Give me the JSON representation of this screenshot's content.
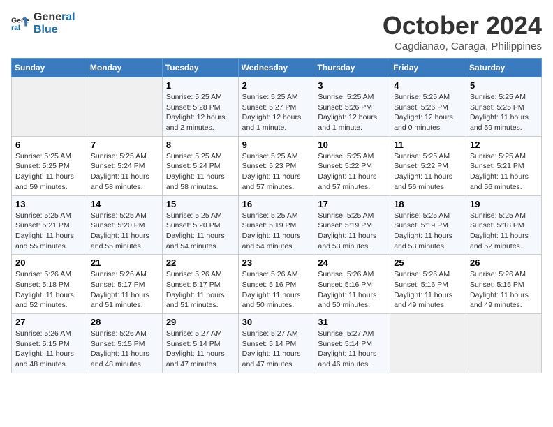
{
  "header": {
    "logo_line1": "General",
    "logo_line2": "Blue",
    "month": "October 2024",
    "location": "Cagdianao, Caraga, Philippines"
  },
  "weekdays": [
    "Sunday",
    "Monday",
    "Tuesday",
    "Wednesday",
    "Thursday",
    "Friday",
    "Saturday"
  ],
  "weeks": [
    [
      {
        "day": "",
        "info": ""
      },
      {
        "day": "",
        "info": ""
      },
      {
        "day": "1",
        "info": "Sunrise: 5:25 AM\nSunset: 5:28 PM\nDaylight: 12 hours\nand 2 minutes."
      },
      {
        "day": "2",
        "info": "Sunrise: 5:25 AM\nSunset: 5:27 PM\nDaylight: 12 hours\nand 1 minute."
      },
      {
        "day": "3",
        "info": "Sunrise: 5:25 AM\nSunset: 5:26 PM\nDaylight: 12 hours\nand 1 minute."
      },
      {
        "day": "4",
        "info": "Sunrise: 5:25 AM\nSunset: 5:26 PM\nDaylight: 12 hours\nand 0 minutes."
      },
      {
        "day": "5",
        "info": "Sunrise: 5:25 AM\nSunset: 5:25 PM\nDaylight: 11 hours\nand 59 minutes."
      }
    ],
    [
      {
        "day": "6",
        "info": "Sunrise: 5:25 AM\nSunset: 5:25 PM\nDaylight: 11 hours\nand 59 minutes."
      },
      {
        "day": "7",
        "info": "Sunrise: 5:25 AM\nSunset: 5:24 PM\nDaylight: 11 hours\nand 58 minutes."
      },
      {
        "day": "8",
        "info": "Sunrise: 5:25 AM\nSunset: 5:24 PM\nDaylight: 11 hours\nand 58 minutes."
      },
      {
        "day": "9",
        "info": "Sunrise: 5:25 AM\nSunset: 5:23 PM\nDaylight: 11 hours\nand 57 minutes."
      },
      {
        "day": "10",
        "info": "Sunrise: 5:25 AM\nSunset: 5:22 PM\nDaylight: 11 hours\nand 57 minutes."
      },
      {
        "day": "11",
        "info": "Sunrise: 5:25 AM\nSunset: 5:22 PM\nDaylight: 11 hours\nand 56 minutes."
      },
      {
        "day": "12",
        "info": "Sunrise: 5:25 AM\nSunset: 5:21 PM\nDaylight: 11 hours\nand 56 minutes."
      }
    ],
    [
      {
        "day": "13",
        "info": "Sunrise: 5:25 AM\nSunset: 5:21 PM\nDaylight: 11 hours\nand 55 minutes."
      },
      {
        "day": "14",
        "info": "Sunrise: 5:25 AM\nSunset: 5:20 PM\nDaylight: 11 hours\nand 55 minutes."
      },
      {
        "day": "15",
        "info": "Sunrise: 5:25 AM\nSunset: 5:20 PM\nDaylight: 11 hours\nand 54 minutes."
      },
      {
        "day": "16",
        "info": "Sunrise: 5:25 AM\nSunset: 5:19 PM\nDaylight: 11 hours\nand 54 minutes."
      },
      {
        "day": "17",
        "info": "Sunrise: 5:25 AM\nSunset: 5:19 PM\nDaylight: 11 hours\nand 53 minutes."
      },
      {
        "day": "18",
        "info": "Sunrise: 5:25 AM\nSunset: 5:19 PM\nDaylight: 11 hours\nand 53 minutes."
      },
      {
        "day": "19",
        "info": "Sunrise: 5:25 AM\nSunset: 5:18 PM\nDaylight: 11 hours\nand 52 minutes."
      }
    ],
    [
      {
        "day": "20",
        "info": "Sunrise: 5:26 AM\nSunset: 5:18 PM\nDaylight: 11 hours\nand 52 minutes."
      },
      {
        "day": "21",
        "info": "Sunrise: 5:26 AM\nSunset: 5:17 PM\nDaylight: 11 hours\nand 51 minutes."
      },
      {
        "day": "22",
        "info": "Sunrise: 5:26 AM\nSunset: 5:17 PM\nDaylight: 11 hours\nand 51 minutes."
      },
      {
        "day": "23",
        "info": "Sunrise: 5:26 AM\nSunset: 5:16 PM\nDaylight: 11 hours\nand 50 minutes."
      },
      {
        "day": "24",
        "info": "Sunrise: 5:26 AM\nSunset: 5:16 PM\nDaylight: 11 hours\nand 50 minutes."
      },
      {
        "day": "25",
        "info": "Sunrise: 5:26 AM\nSunset: 5:16 PM\nDaylight: 11 hours\nand 49 minutes."
      },
      {
        "day": "26",
        "info": "Sunrise: 5:26 AM\nSunset: 5:15 PM\nDaylight: 11 hours\nand 49 minutes."
      }
    ],
    [
      {
        "day": "27",
        "info": "Sunrise: 5:26 AM\nSunset: 5:15 PM\nDaylight: 11 hours\nand 48 minutes."
      },
      {
        "day": "28",
        "info": "Sunrise: 5:26 AM\nSunset: 5:15 PM\nDaylight: 11 hours\nand 48 minutes."
      },
      {
        "day": "29",
        "info": "Sunrise: 5:27 AM\nSunset: 5:14 PM\nDaylight: 11 hours\nand 47 minutes."
      },
      {
        "day": "30",
        "info": "Sunrise: 5:27 AM\nSunset: 5:14 PM\nDaylight: 11 hours\nand 47 minutes."
      },
      {
        "day": "31",
        "info": "Sunrise: 5:27 AM\nSunset: 5:14 PM\nDaylight: 11 hours\nand 46 minutes."
      },
      {
        "day": "",
        "info": ""
      },
      {
        "day": "",
        "info": ""
      }
    ]
  ]
}
